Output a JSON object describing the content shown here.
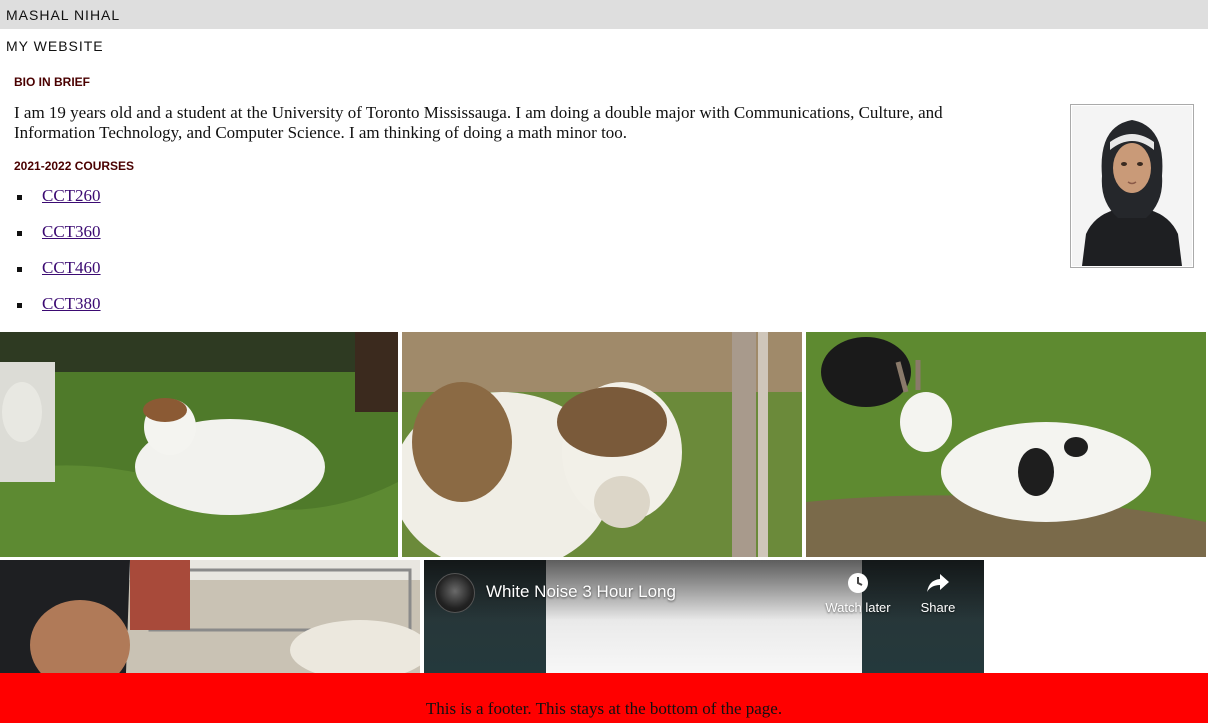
{
  "header": {
    "name": "MASHAL NIHAL"
  },
  "site": {
    "title": "MY WEBSITE"
  },
  "bio": {
    "heading": "BIO IN BRIEF",
    "text": "I am 19 years old and a student at the University of Toronto Mississauga. I am doing a double major with Communications, Culture, and Information Technology, and Computer Science. I am thinking of doing a math minor too."
  },
  "courses": {
    "heading": "2021-2022 COURSES",
    "items": [
      "CCT260",
      "CCT360",
      "CCT460",
      "CCT380"
    ]
  },
  "video": {
    "title": "White Noise 3 Hour Long",
    "watch_later": "Watch later",
    "share": "Share",
    "icons": {
      "watch_later": "clock-icon",
      "share": "share-arrow-icon"
    }
  },
  "footer": {
    "text": "This is a footer. This stays at the bottom of the page."
  },
  "colors": {
    "footer_bg": "#ff0000",
    "heading": "#4a0000",
    "link": "#3b0a72",
    "topbar_bg": "#dedede"
  }
}
